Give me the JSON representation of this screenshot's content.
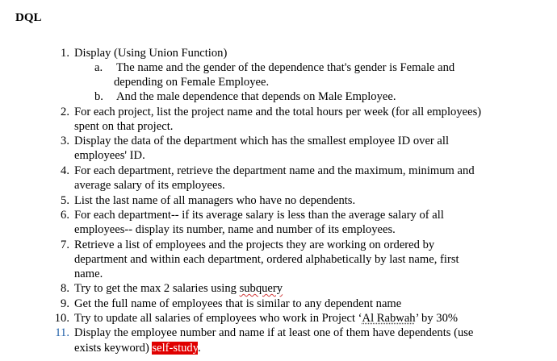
{
  "heading": "DQL",
  "items": [
    {
      "num": "1.",
      "lines": [
        "Display (Using Union Function)"
      ]
    },
    {
      "num": "a.",
      "lines": [
        "The name and the gender of the dependence that's gender is Female and",
        "depending on Female Employee."
      ]
    },
    {
      "num": "b.",
      "lines": [
        "And the male dependence that depends on Male Employee."
      ]
    },
    {
      "num": "2.",
      "lines": [
        "For each project, list the project name and the total hours per week (for all employees)",
        "spent on that project."
      ]
    },
    {
      "num": "3.",
      "lines": [
        "Display the data of the department which has the smallest employee ID over all",
        "employees' ID."
      ]
    },
    {
      "num": "4.",
      "lines": [
        "For each department, retrieve the department name and the maximum, minimum and",
        "average salary of its employees."
      ]
    },
    {
      "num": "5.",
      "lines": [
        "List the last name of all managers who have no dependents."
      ]
    },
    {
      "num": "6.",
      "lines": [
        "For each department-- if its average salary is less than the average salary of all",
        "employees-- display its number, name and number of its employees."
      ]
    },
    {
      "num": "7.",
      "lines": [
        "Retrieve a list of employees and the projects they are working on ordered by",
        "department and within each department, ordered alphabetically by last name, first",
        "name."
      ]
    },
    {
      "num": "8.",
      "line_pre": "Try to get the max 2 salaries using ",
      "line_squiggle": "subquery"
    },
    {
      "num": "9.",
      "lines": [
        "Get the full name of employees that is similar to any dependent name"
      ]
    },
    {
      "num": "10.",
      "line_pre": "Try to update all salaries of employees who work in Project ‘",
      "line_dotted": "Al Rabwah",
      "line_post": "’ by 30%"
    },
    {
      "num": "11.",
      "lines": [
        "Display the employee number and name if at least one of them have dependents (use"
      ],
      "line2_pre": "exists keyword) ",
      "line2_highlight": "self-study",
      "line2_post": "."
    }
  ]
}
